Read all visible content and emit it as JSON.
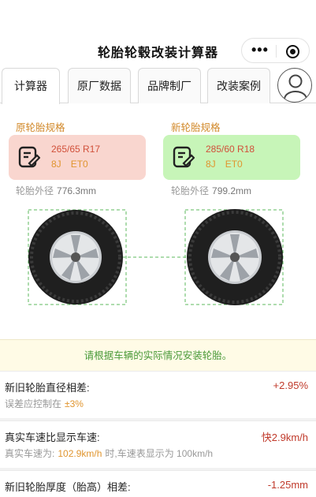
{
  "nav": {
    "title": "轮胎轮毂改装计算器",
    "menu_icon": "more-dots-icon",
    "close_icon": "target-close-icon"
  },
  "tabs": [
    {
      "label": "计算器"
    },
    {
      "label": "原厂数据"
    },
    {
      "label": "品牌制厂"
    },
    {
      "label": "改装案例"
    }
  ],
  "original": {
    "label": "原轮胎规格",
    "tire_size": "265/65 R17",
    "rim_width": "8J",
    "offset": "ET0",
    "diameter_label": "轮胎外径",
    "diameter": "776.3mm"
  },
  "new": {
    "label": "新轮胎规格",
    "tire_size": "285/60 R18",
    "rim_width": "8J",
    "offset": "ET0",
    "diameter_label": "轮胎外径",
    "diameter": "799.2mm"
  },
  "hint": "请根据车辆的实际情况安装轮胎。",
  "results": {
    "diameter_diff": {
      "title": "新旧轮胎直径相差:",
      "value": "+2.95%",
      "sub_prefix": "误差应控制在",
      "sub_value": "±3%"
    },
    "speed": {
      "title": "真实车速比显示车速:",
      "value": "快2.9km/h",
      "sub_prefix": "真实车速为:",
      "sub_value": "102.9km/h",
      "sub_suffix": "时,车速表显示为 100km/h"
    },
    "thickness": {
      "title": "新旧轮胎厚度（胎高）相差:",
      "value": "-1.25mm"
    }
  },
  "colors": {
    "accent_orange": "#e0952f",
    "accent_red": "#c03a2b",
    "green": "#5cb85c"
  }
}
